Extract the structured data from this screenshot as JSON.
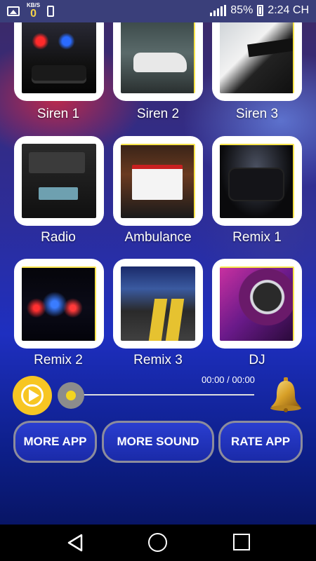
{
  "status_bar": {
    "speed_unit": "KB/S",
    "speed_value": "0",
    "battery": "85%",
    "time": "2:24 CH",
    "icons": [
      "image-icon",
      "usb-icon",
      "signal-icon",
      "battery-icon"
    ]
  },
  "sounds": [
    {
      "label": "Siren 1",
      "image": "siren-1-image"
    },
    {
      "label": "Siren 2",
      "image": "siren-2-image"
    },
    {
      "label": "Siren 3",
      "image": "siren-3-image"
    },
    {
      "label": "Radio",
      "image": "radio-image"
    },
    {
      "label": "Ambulance",
      "image": "ambulance-image"
    },
    {
      "label": "Remix 1",
      "image": "remix-1-image"
    },
    {
      "label": "Remix 2",
      "image": "remix-2-image"
    },
    {
      "label": "Remix 3",
      "image": "remix-3-image"
    },
    {
      "label": "DJ",
      "image": "dj-image"
    }
  ],
  "player": {
    "time": "00:00 / 00:00",
    "progress": 0,
    "play_color": "#f7c623"
  },
  "buttons": {
    "more_app": "MORE APP",
    "more_sound": "MORE SOUND",
    "rate_app": "RATE APP"
  },
  "nav": {
    "icons": [
      "back-icon",
      "home-icon",
      "recents-icon"
    ]
  }
}
